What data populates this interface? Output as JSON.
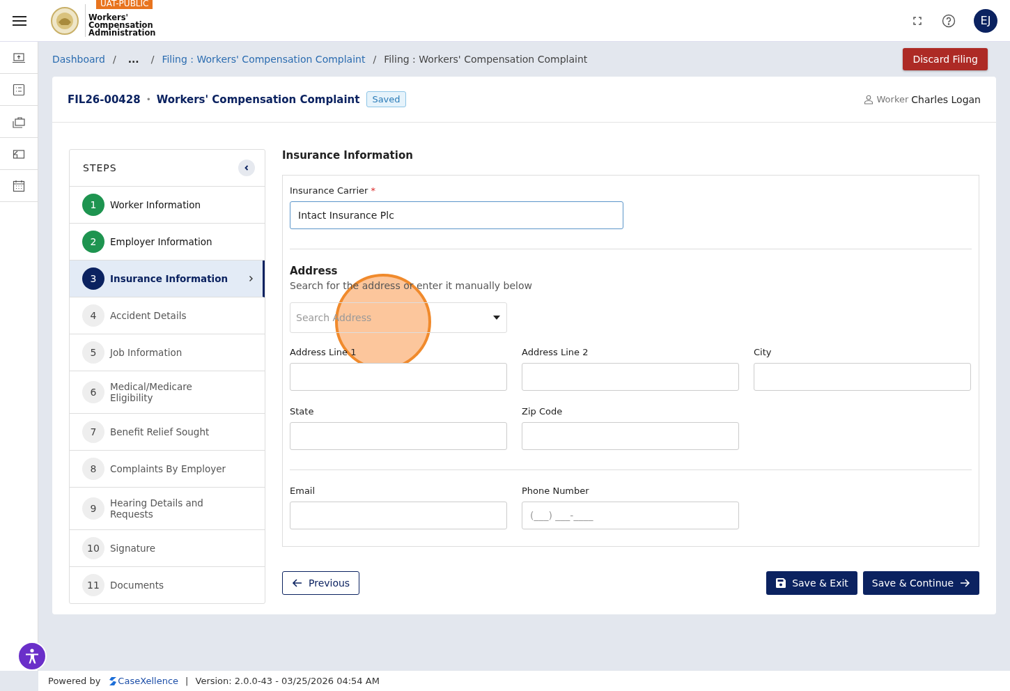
{
  "header": {
    "env_badge": "UAT-PUBLIC",
    "logo_lines": [
      "Workers'",
      "Compensation",
      "Administration"
    ],
    "avatar": "EJ"
  },
  "side_nav": [
    {
      "kind": "upload"
    },
    {
      "kind": "checklist"
    },
    {
      "kind": "briefcase"
    },
    {
      "kind": "edit"
    },
    {
      "kind": "calendar"
    }
  ],
  "breadcrumbs": [
    {
      "label": "Dashboard",
      "kind": "link"
    },
    {
      "separator": "/",
      "label": "...",
      "kind": "ellipsis"
    },
    {
      "separator": "/",
      "label": "Filing : Workers' Compensation Complaint",
      "kind": "link"
    },
    {
      "separator": "/",
      "label": "Filing : Workers' Compensation Complaint",
      "kind": "current"
    }
  ],
  "discard_button": "Discard Filing",
  "filing": {
    "id": "FIL26-00428",
    "separator": "•",
    "title": "Workers' Compensation Complaint",
    "status": "Saved",
    "worker_label": "Worker",
    "worker_name": "Charles Logan"
  },
  "steps_title": "STEPS",
  "steps": [
    {
      "number": "1",
      "label": "Worker Information",
      "completed": true,
      "selected": false
    },
    {
      "number": "2",
      "label": "Employer Information",
      "completed": true,
      "selected": false
    },
    {
      "number": "3",
      "label": "Insurance Information",
      "completed": false,
      "selected": true
    },
    {
      "number": "4",
      "label": "Accident Details",
      "completed": false,
      "selected": false
    },
    {
      "number": "5",
      "label": "Job Information",
      "completed": false,
      "selected": false
    },
    {
      "number": "6",
      "label": "Medical/Medicare Eligibility",
      "completed": false,
      "selected": false
    },
    {
      "number": "7",
      "label": "Benefit Relief Sought",
      "completed": false,
      "selected": false
    },
    {
      "number": "8",
      "label": "Complaints By Employer",
      "completed": false,
      "selected": false
    },
    {
      "number": "9",
      "label": "Hearing Details and Requests",
      "completed": false,
      "selected": false
    },
    {
      "number": "10",
      "label": "Signature",
      "completed": false,
      "selected": false
    },
    {
      "number": "11",
      "label": "Documents",
      "completed": false,
      "selected": false
    }
  ],
  "section_title": "Insurance Information",
  "carrier": {
    "label": "Insurance Carrier",
    "required_mark": "*",
    "value": "Intact Insurance Plc",
    "focused": true
  },
  "address": {
    "title": "Address",
    "hint": "Search for the address or enter it manually below",
    "search_placeholder": "Search Address",
    "fields": [
      {
        "label": "Address Line 1"
      },
      {
        "label": "Address Line 2"
      },
      {
        "label": "City"
      },
      {
        "label": "State"
      },
      {
        "label": "Zip Code"
      }
    ]
  },
  "contact_fields": [
    {
      "label": "Email"
    },
    {
      "label": "Phone Number",
      "placeholder": "(___) ___-____"
    }
  ],
  "buttons": {
    "previous": "Previous",
    "save_exit": "Save & Exit",
    "save_continue": "Save & Continue"
  },
  "footer": {
    "powered_by": "Powered by",
    "brand": "CaseXellence",
    "separator": "|",
    "version": "Version: 2.0.0-43 - 03/25/2026 04:54 AM"
  }
}
